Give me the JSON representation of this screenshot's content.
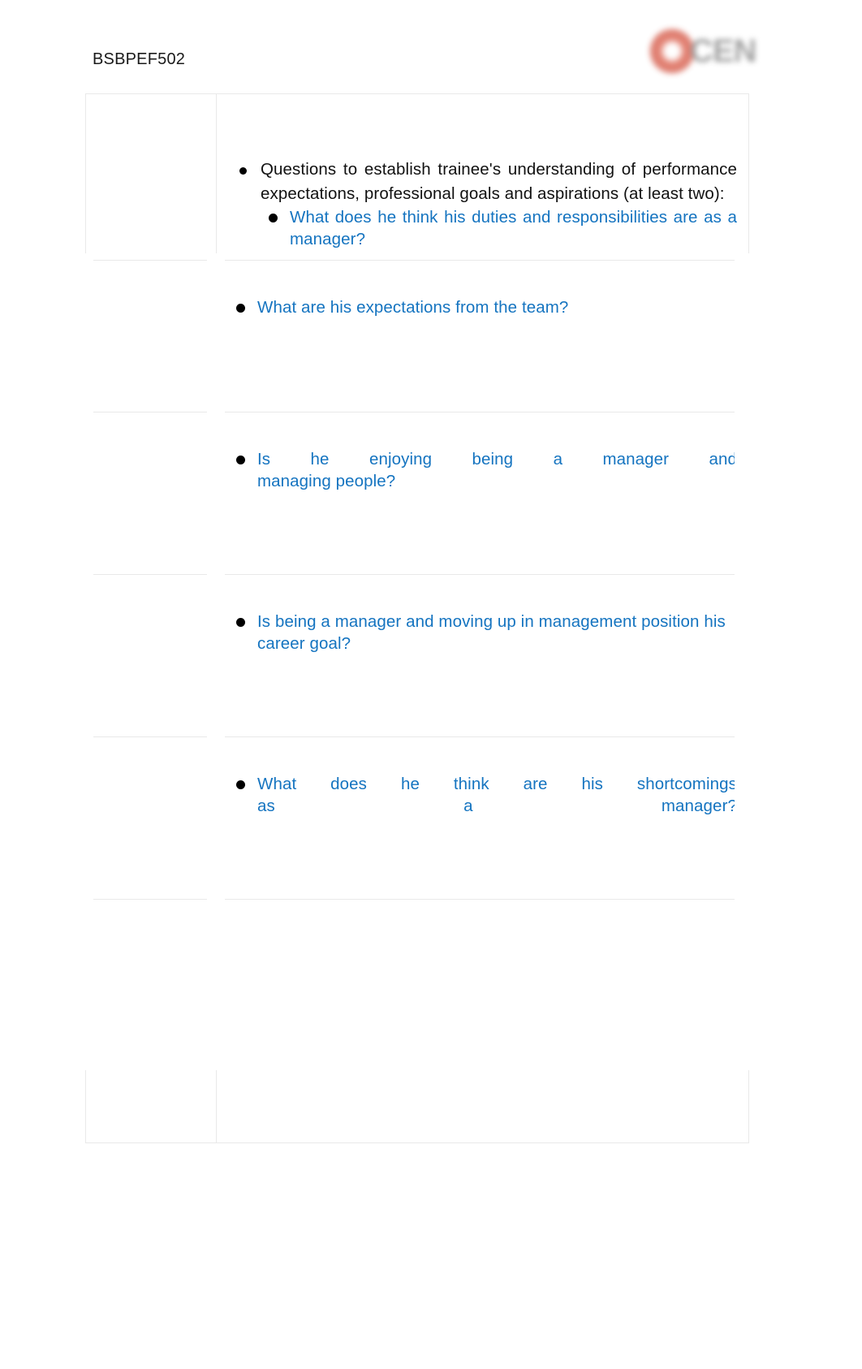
{
  "header": {
    "doc_code": "BSBPEF502",
    "logo": {
      "name": "ocen-logo",
      "wordmark": "CEN",
      "ring_color": "#d65f4e",
      "word_color": "#9b9b9b"
    }
  },
  "theme": {
    "question_color": "#1574c0",
    "body_color": "#111111",
    "border_color": "#e9e9e9",
    "page_background": "#ffffff"
  },
  "table": {
    "columns": 3,
    "rows": [
      {
        "id": "row-intro",
        "col1": "",
        "prompt": {
          "text": "Questions to establish trainee's understanding of performance expectations, professional goals and aspirations (at least two):",
          "justified": true
        },
        "question": {
          "line1": "What does he think his duties and responsibilities are as a",
          "line2": "manager?",
          "full": "What does he think his duties and responsibilities are as a manager?",
          "justified": false
        }
      },
      {
        "id": "row-q2",
        "col1": "",
        "question": {
          "line1": "What are his expectations from the team?",
          "line2": "",
          "full": "What are his expectations from the team?",
          "justified": false
        }
      },
      {
        "id": "row-q3",
        "col1": "",
        "question": {
          "line1": "Is he enjoying being a manager and",
          "line2": "managing people?",
          "full": "Is he enjoying being a manager and managing people?",
          "justified": true
        }
      },
      {
        "id": "row-q4",
        "col1": "",
        "question": {
          "line1": "Is being a manager and moving up in management position his",
          "line2": "career goal?",
          "full": "Is being a manager and moving up in management position his career goal?",
          "justified": false
        }
      },
      {
        "id": "row-q5",
        "col1": "",
        "question": {
          "line1": "What does he think are his shortcomings",
          "line2": "as a manager?",
          "full": "What does he think are his shortcomings as a manager?",
          "justified": true
        }
      },
      {
        "id": "row-blank",
        "col1": "",
        "question": {
          "line1": "",
          "line2": "",
          "full": "",
          "justified": false
        }
      }
    ]
  }
}
